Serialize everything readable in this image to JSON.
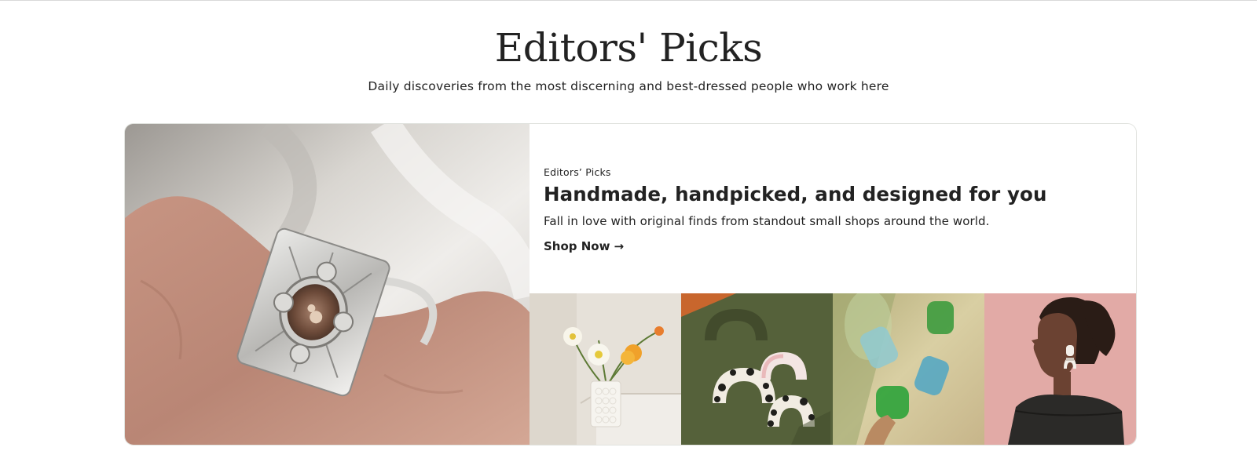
{
  "header": {
    "title": "Editors' Picks",
    "subtitle": "Daily discoveries from the most discerning and best-dressed people who work here"
  },
  "promo": {
    "eyebrow": "Editors’ Picks",
    "headline": "Handmade, handpicked, and designed for you",
    "description": "Fall in love with original finds from standout small shops around the world.",
    "cta_label": "Shop Now",
    "cta_arrow": "→"
  },
  "images": {
    "hero": "sterling-silver-agate-ring",
    "thumbs": [
      "white-vase-with-poppies",
      "ceramic-arch-sculptures",
      "colored-glass-cups",
      "woman-with-statement-earrings"
    ]
  },
  "colors": {
    "text": "#222222",
    "card_border": "#e1e3df",
    "thumb_backgrounds": [
      "#e6e1d9",
      "#55613a",
      "#c9b98a",
      "#e2aaa6"
    ]
  }
}
